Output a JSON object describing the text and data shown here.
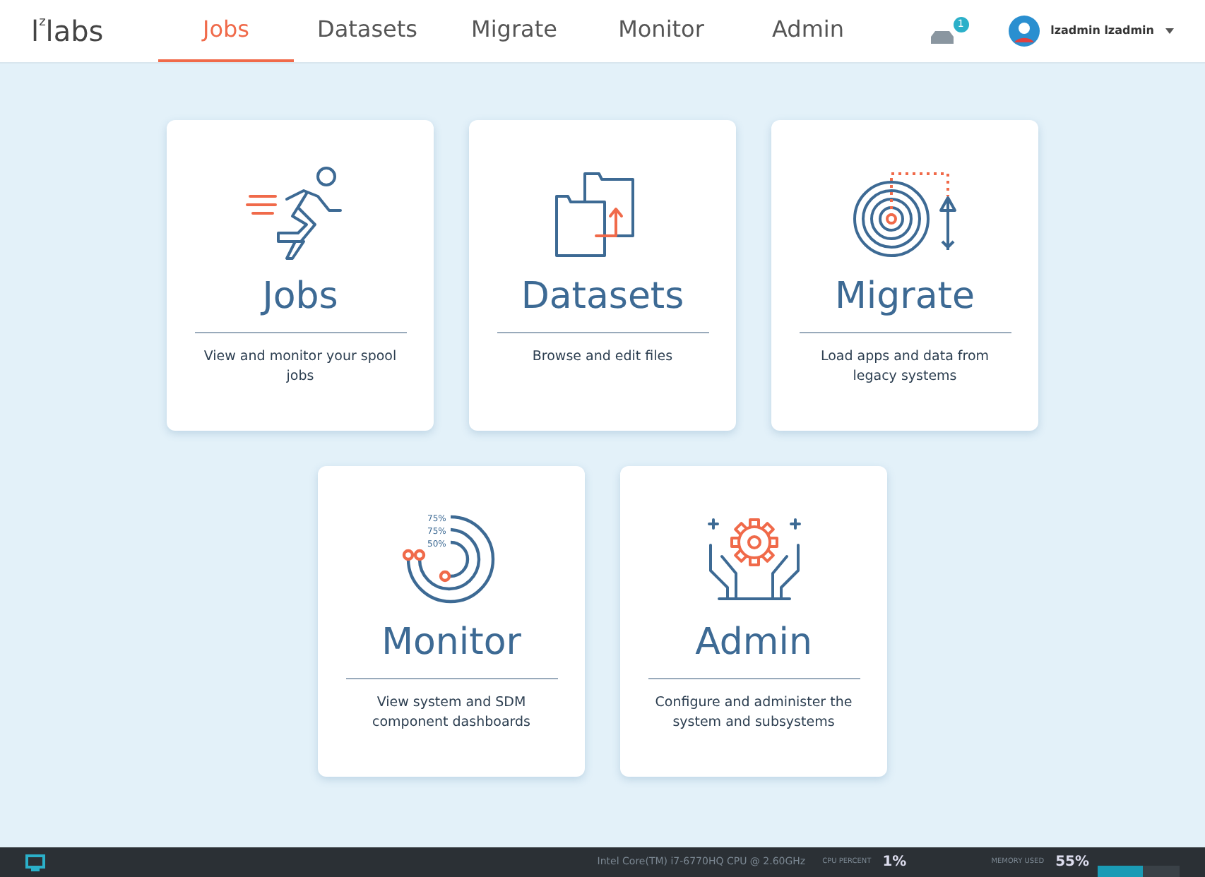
{
  "header": {
    "logo": {
      "main": "l",
      "sup": "z",
      "rest": "labs"
    },
    "tabs": [
      {
        "label": "Jobs",
        "selected": true
      },
      {
        "label": "Datasets",
        "selected": false
      },
      {
        "label": "Migrate",
        "selected": false
      },
      {
        "label": "Monitor",
        "selected": false
      },
      {
        "label": "Admin",
        "selected": false
      }
    ],
    "notification_count": "1",
    "user": "lzadmin lzadmin"
  },
  "cards": [
    {
      "kind": "jobs",
      "title": "Jobs",
      "description": "View and monitor your spool jobs"
    },
    {
      "kind": "datasets",
      "title": "Datasets",
      "description": "Browse and edit files"
    },
    {
      "kind": "migrate",
      "title": "Migrate",
      "description": "Load apps and data from legacy systems"
    },
    {
      "kind": "monitor",
      "title": "Monitor",
      "description": "View system and SDM component dashboards",
      "icon_labels": [
        "75%",
        "75%",
        "50%"
      ]
    },
    {
      "kind": "admin",
      "title": "Admin",
      "description": "Configure and administer the system and subsystems"
    }
  ],
  "status_bar": {
    "cpu_name": "Intel Core(TM) i7-6770HQ CPU @ 2.60GHz",
    "cpu_label": "CPU PERCENT",
    "cpu_value": "1%",
    "memory_label": "MEMORY USED",
    "memory_value": "55%",
    "memory_meter": {
      "level": 0.55
    }
  }
}
